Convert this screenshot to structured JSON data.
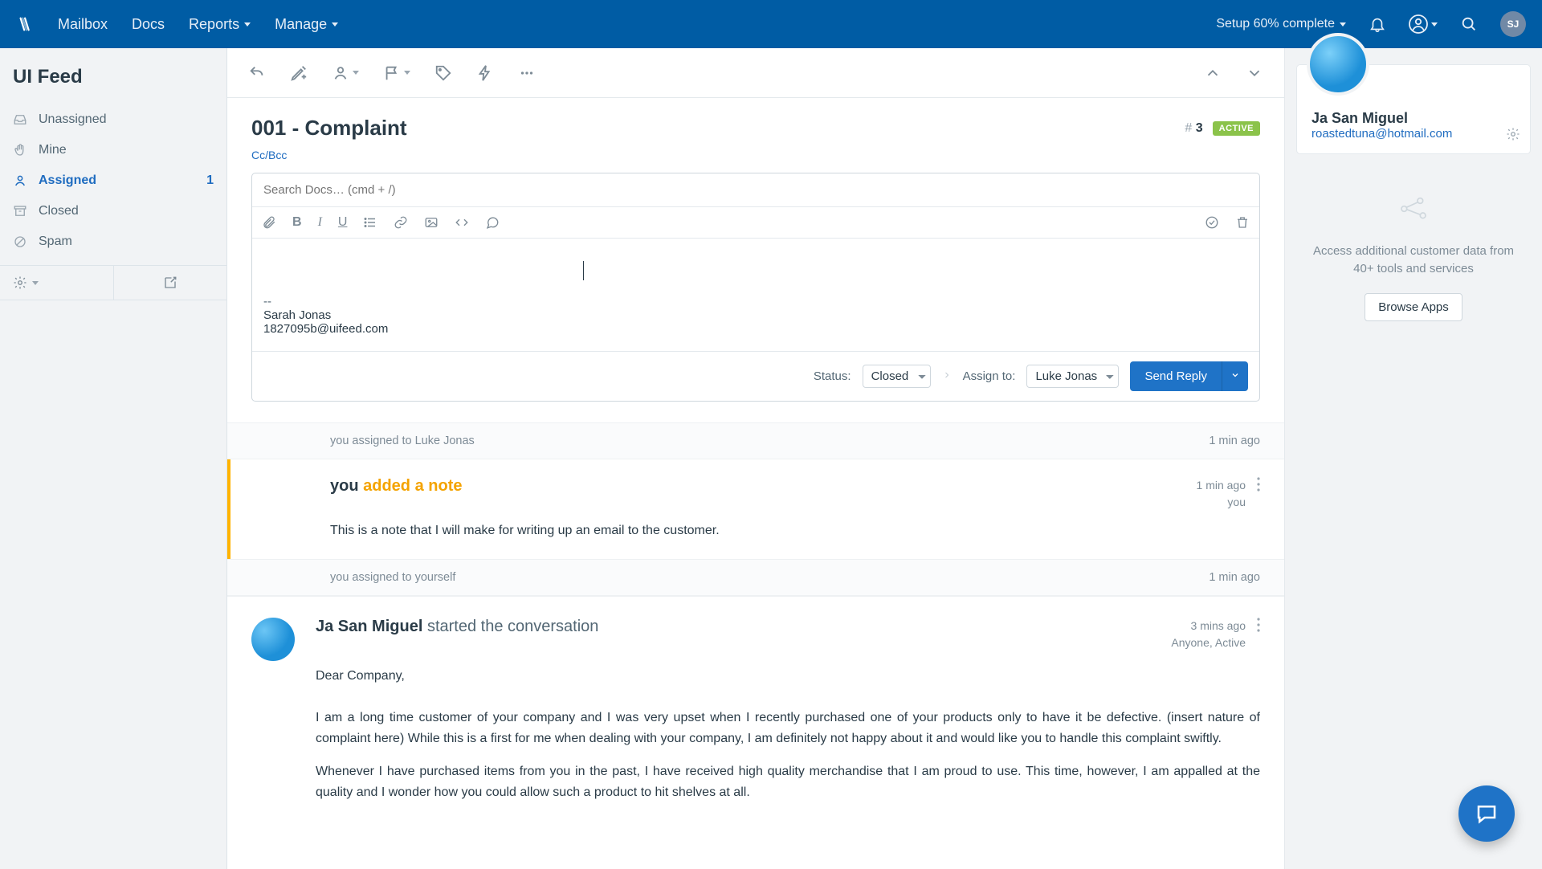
{
  "topnav": {
    "items": [
      "Mailbox",
      "Docs",
      "Reports",
      "Manage"
    ],
    "setup": "Setup 60% complete",
    "avatar_initials": "SJ"
  },
  "sidebar": {
    "title": "UI Feed",
    "items": [
      {
        "label": "Unassigned"
      },
      {
        "label": "Mine"
      },
      {
        "label": "Assigned",
        "count": "1",
        "active": true
      },
      {
        "label": "Closed"
      },
      {
        "label": "Spam"
      }
    ]
  },
  "conversation": {
    "title": "001 - Complaint",
    "number": "3",
    "status": "ACTIVE",
    "ccbcc": "Cc/Bcc",
    "search_placeholder": "Search Docs… (cmd + /)",
    "signature": {
      "dashes": "--",
      "name": "Sarah Jonas",
      "email": "1827095b@uifeed.com"
    },
    "footer": {
      "status_label": "Status:",
      "status_value": "Closed",
      "assign_label": "Assign to:",
      "assign_value": "Luke Jonas",
      "send": "Send Reply"
    }
  },
  "activity": {
    "assign1": {
      "text": "you assigned to Luke Jonas",
      "time": "1 min ago"
    },
    "note": {
      "author": "you",
      "action": "added a note",
      "time": "1 min ago",
      "by": "you",
      "body": "This is a note that I will make for writing up an email to the customer."
    },
    "assign2": {
      "text": "you assigned to yourself",
      "time": "1 min ago"
    },
    "message": {
      "author": "Ja San Miguel",
      "action": "started the conversation",
      "time": "3 mins ago",
      "meta": "Anyone, Active",
      "greeting": "Dear Company,",
      "p1": "I am a long time customer of your company and I was very upset when I recently purchased one of your products only to have it be defective. (insert nature of complaint here) While this is a first for me when dealing with your company, I am definitely not happy about it and would like you to handle this complaint swiftly.",
      "p2": "Whenever I have purchased items from you in the past, I have received high quality merchandise that I am proud to use. This time, however, I am appalled at the quality and I wonder how you could allow such a product to hit shelves at all."
    }
  },
  "profile": {
    "name": "Ja San Miguel",
    "email": "roastedtuna@hotmail.com"
  },
  "apps": {
    "blurb": "Access additional customer data from 40+ tools and services",
    "button": "Browse Apps"
  }
}
